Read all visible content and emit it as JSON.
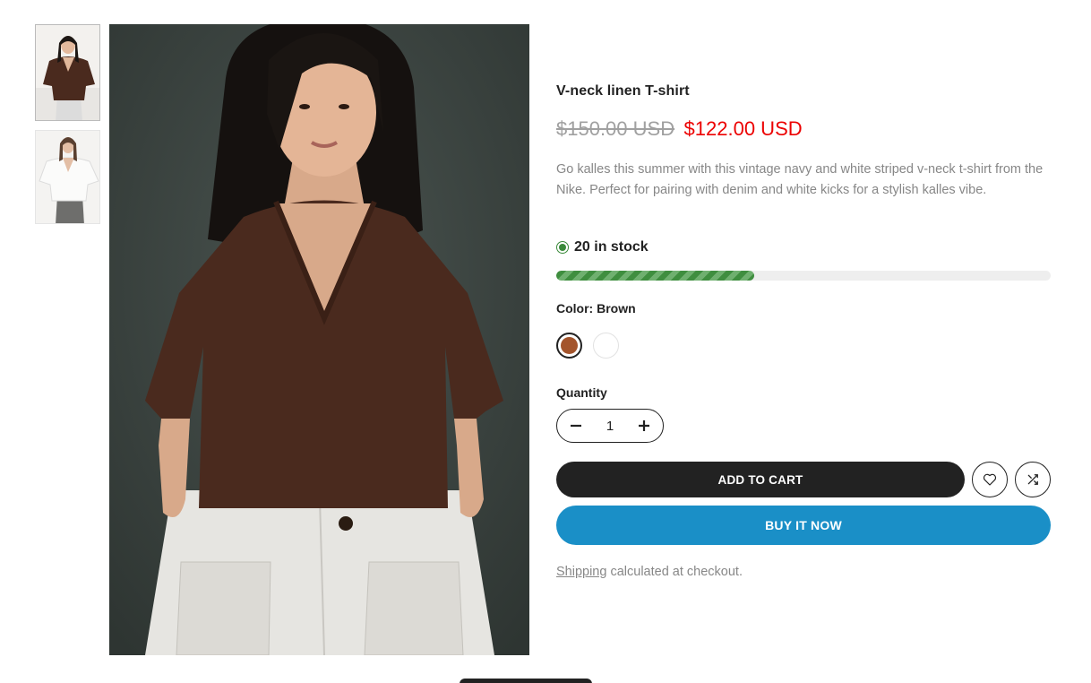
{
  "product": {
    "title": "V-neck linen T-shirt",
    "price_old": "$150.00 USD",
    "price_new": "$122.00 USD",
    "description": "Go kalles this summer with this vintage navy and white striped v-neck t-shirt from the Nike. Perfect for pairing with denim and white kicks for a stylish kalles vibe.",
    "stock_text": "20 in stock",
    "stock_level": 0.4
  },
  "color": {
    "label": "Color:",
    "selected": "Brown",
    "swatches": [
      {
        "name": "Brown",
        "hex": "#a3542c"
      },
      {
        "name": "White",
        "hex": "#ffffff"
      }
    ]
  },
  "quantity": {
    "label": "Quantity",
    "value": "1"
  },
  "buttons": {
    "add_to_cart": "ADD TO CART",
    "buy_now": "BUY IT NOW"
  },
  "shipping": {
    "link": "Shipping",
    "text": "calculated at checkout."
  },
  "colors": {
    "sale_price": "#ec0101",
    "buy_now": "#1a8fc7",
    "stock": "#3f8e3f",
    "shirt_brown": "#4a2a1e"
  }
}
